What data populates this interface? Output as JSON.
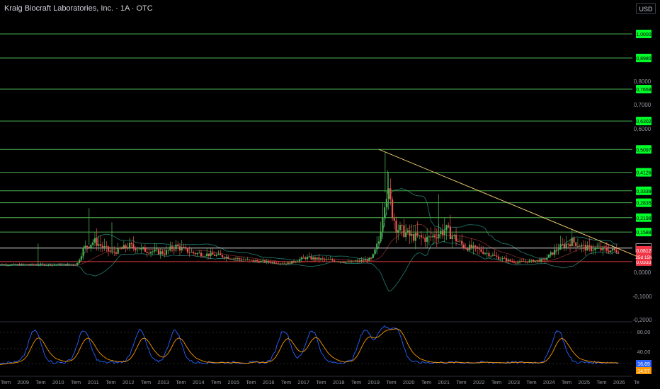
{
  "header": {
    "title": "Kraig Biocraft Laboratories, Inc. · 1A · OTC",
    "currency": "USD"
  },
  "colors": {
    "background": "#000000",
    "level_line": "#4caf50",
    "level_tag": "#00ff2a",
    "trendline": "#e9c46a",
    "support_line": "#d63a3a",
    "price_up": "#26a69a",
    "price_down": "#ef5350",
    "current_tag": "#f23645",
    "rsi_fast": "#2962ff",
    "rsi_slow": "#ff9800"
  },
  "chart_data": {
    "type": "candlestick",
    "price_axis": {
      "labels": [
        "1,0000",
        "0,8980",
        "0,8000",
        "0,7658",
        "0,7000",
        "0,6302",
        "0,6000",
        "0,5097",
        "0,4126",
        "0,3339",
        "0,2835",
        "0,2198",
        "0,1588",
        "0,0910",
        "0,0812",
        "0,0333",
        "0,0000",
        "-0,1000",
        "-0,2000"
      ]
    },
    "level_lines": [
      {
        "value": 1.0,
        "label": "1,0000"
      },
      {
        "value": 0.898,
        "label": "0,8980"
      },
      {
        "value": 0.7658,
        "label": "0,7658"
      },
      {
        "value": 0.6302,
        "label": "0,6302"
      },
      {
        "value": 0.5097,
        "label": "0,5097"
      },
      {
        "value": 0.4126,
        "label": "0,4126"
      },
      {
        "value": 0.3339,
        "label": "0,3339"
      },
      {
        "value": 0.2835,
        "label": "0,2835"
      },
      {
        "value": 0.2198,
        "label": "0,2198"
      },
      {
        "value": 0.1588,
        "label": "0,1588"
      }
    ],
    "current_price": {
      "value": 0.0812,
      "label": "0,0812",
      "countdown": "25d 15h"
    },
    "white_level": {
      "value": 0.091,
      "label": "0,0910"
    },
    "support_level": {
      "value": 0.0333,
      "label": "0,0333"
    },
    "trendline": {
      "from": {
        "year": 2019.1,
        "value": 0.51
      },
      "to": {
        "year": 2026.8,
        "value": 0.034
      }
    },
    "time_axis": {
      "labels": [
        "Tem",
        "2009",
        "Tem",
        "2010",
        "Tem",
        "2011",
        "Tem",
        "2012",
        "Tem",
        "2013",
        "Tem",
        "2014",
        "Tem",
        "2015",
        "Tem",
        "2016",
        "Tem",
        "2017",
        "Tem",
        "2018",
        "Tem",
        "2019",
        "Tem",
        "2020",
        "Tem",
        "2021",
        "Tem",
        "2022",
        "Tem",
        "2023",
        "Tem",
        "2024",
        "Tem",
        "2025",
        "Tem",
        "2026",
        "Te"
      ]
    },
    "rsi": {
      "axis_labels": [
        "80,00",
        "40,00"
      ],
      "value_fast": "16,69",
      "value_slow": "14,57"
    }
  }
}
